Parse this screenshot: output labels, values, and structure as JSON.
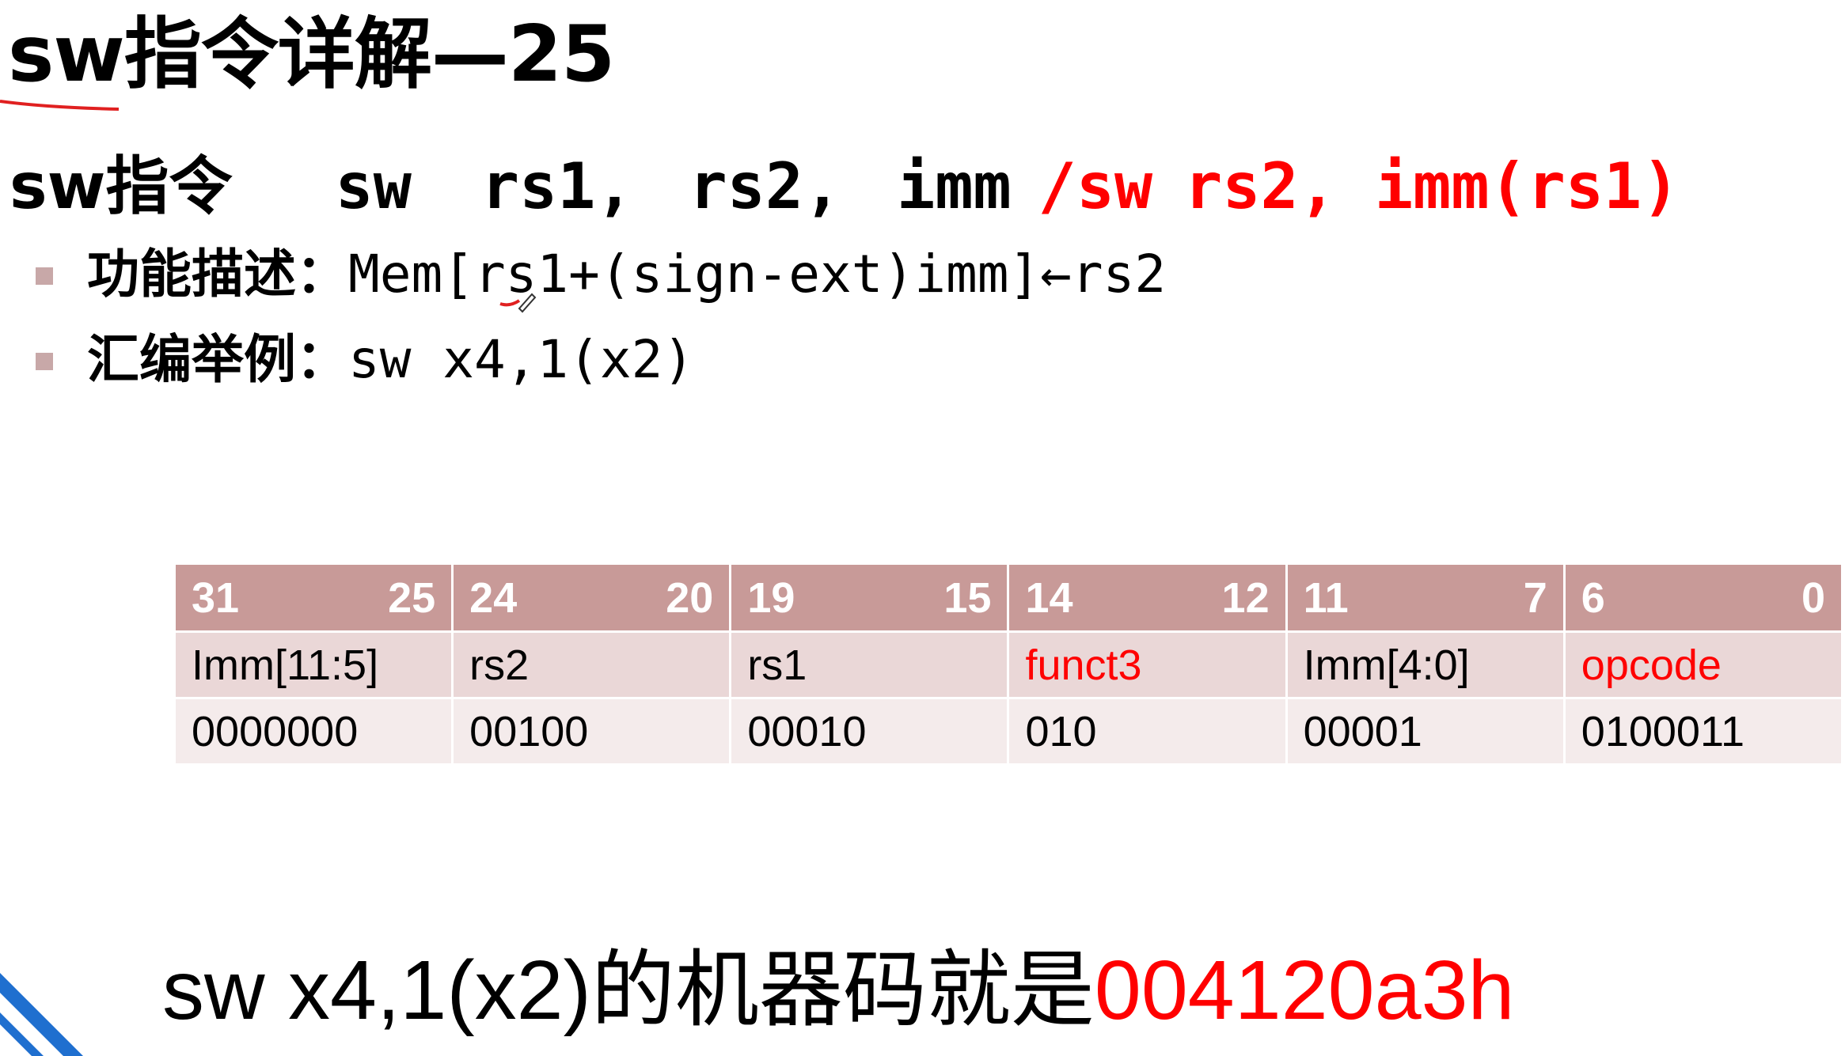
{
  "title": "sw指令详解—25",
  "syntax": {
    "label": "sw指令",
    "mnemonic": "sw",
    "arg1": "rs1,",
    "arg2": "rs2,",
    "arg3": "imm",
    "alt_slash": "/",
    "alt_sw": "sw",
    "alt_rest": "rs2, imm(rs1)"
  },
  "bullets": [
    {
      "label": "功能描述：",
      "code": "Mem[rs1+(sign-ext)imm]←rs2"
    },
    {
      "label": "汇编举例：",
      "code": "sw x4,1(x2)"
    }
  ],
  "encoding": {
    "header": [
      {
        "hi": "31",
        "lo": "25"
      },
      {
        "hi": "24",
        "lo": "20"
      },
      {
        "hi": "19",
        "lo": "15"
      },
      {
        "hi": "14",
        "lo": "12"
      },
      {
        "hi": "11",
        "lo": "7"
      },
      {
        "hi": "6",
        "lo": "0"
      }
    ],
    "fields": [
      "Imm[11:5]",
      "rs2",
      "rs1",
      "funct3",
      "Imm[4:0]",
      "opcode"
    ],
    "bits": [
      "0000000",
      "00100",
      "00010",
      "010",
      "00001",
      "0100011"
    ]
  },
  "result": {
    "prefix": "sw x4,1(x2)的机器码就是",
    "value": "004120a3h"
  },
  "colors": {
    "red": "#ff0000",
    "header_bg": "#c89a98",
    "row1_bg": "#ead7d7",
    "row2_bg": "#f4ebeb",
    "bullet": "#c8a8a8",
    "corner_blue": "#1f6fcf"
  }
}
